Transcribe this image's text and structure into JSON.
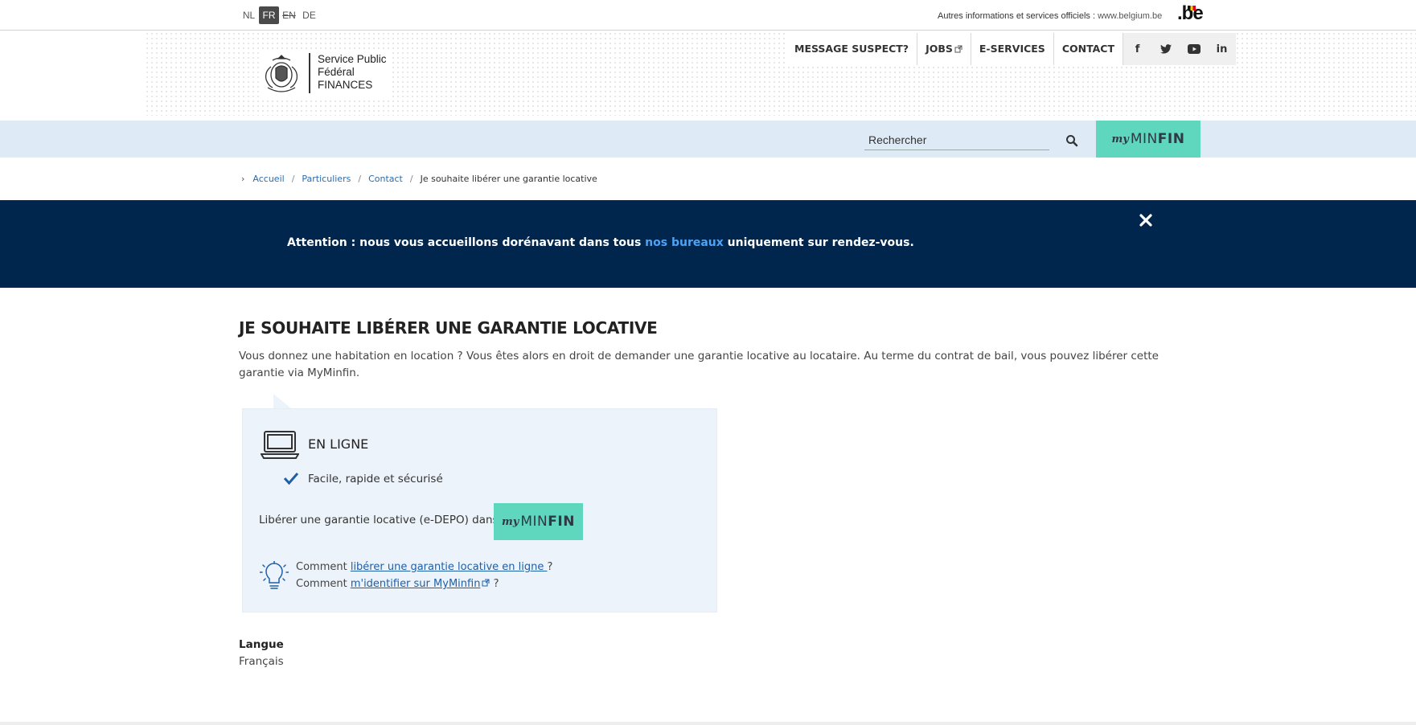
{
  "languages": [
    {
      "code": "NL"
    },
    {
      "code": "FR"
    },
    {
      "code": "EN"
    },
    {
      "code": "DE"
    }
  ],
  "official_info": {
    "label": "Autres informations et services officiels :",
    "link": "www.belgium.be"
  },
  "be_logo": ".be",
  "logo": {
    "line1": "Service Public",
    "line2": "Fédéral",
    "line3": "FINANCES"
  },
  "top_nav": {
    "message_suspect": "MESSAGE SUSPECT?",
    "jobs": "JOBS",
    "e_services": "E-SERVICES",
    "contact": "CONTACT"
  },
  "social": {
    "facebook": "f",
    "linkedin": "in"
  },
  "search": {
    "placeholder": "Rechercher"
  },
  "myminfin": {
    "my": "my",
    "min": "MIN",
    "fin": "FIN"
  },
  "breadcrumb": {
    "items": [
      "Accueil",
      "Particuliers",
      "Contact"
    ],
    "current": "Je souhaite libérer une garantie locative"
  },
  "alert": {
    "before": "Attention : nous vous accueillons dorénavant dans tous ",
    "link": "nos bureaux",
    "after": " uniquement sur rendez-vous."
  },
  "page": {
    "title": "JE SOUHAITE LIBÉRER UNE GARANTIE LOCATIVE",
    "intro": "Vous donnez une habitation en location ? Vous êtes alors en droit de demander une garantie locative au locataire. Au terme du contrat de bail, vous pouvez libérer cette garantie via MyMinfin."
  },
  "card": {
    "title": "EN LIGNE",
    "check_text": "Facile, rapide et sécurisé",
    "release_text": "Libérer une garantie locative (e-DEPO) dans",
    "how1_prefix": "Comment ",
    "how1_link": "libérer une garantie locative en ligne ",
    "how1_suffix": "?",
    "how2_prefix": "Comment ",
    "how2_link": "m'identifier sur MyMinfin",
    "how2_suffix": " ?"
  },
  "language_section": {
    "label": "Langue",
    "value": "Français"
  }
}
